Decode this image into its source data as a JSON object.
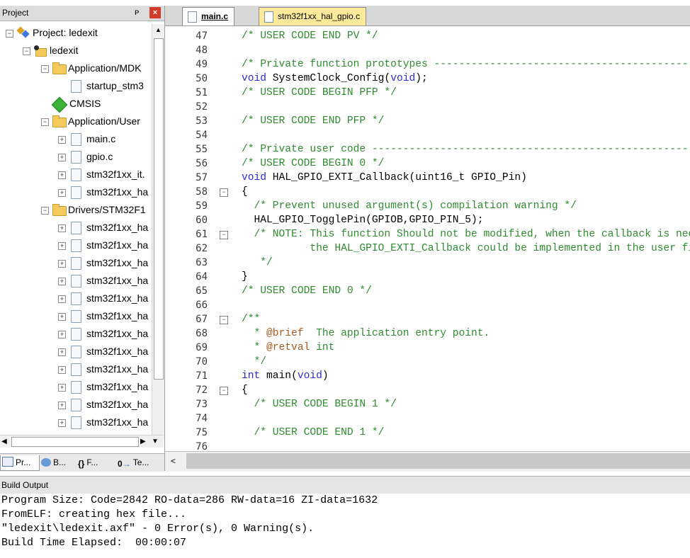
{
  "project_panel": {
    "title": "Project",
    "pin": "ᴘ",
    "close": "×",
    "tree": [
      {
        "label": "Project: ledexit",
        "type": "project",
        "level": 0,
        "expander": "−"
      },
      {
        "label": "ledexit",
        "type": "target",
        "level": 1,
        "expander": "−"
      },
      {
        "label": "Application/MDK",
        "type": "folder",
        "level": 2,
        "expander": "−"
      },
      {
        "label": "startup_stm3",
        "type": "file",
        "level": 3,
        "expander": ""
      },
      {
        "label": "CMSIS",
        "type": "gem",
        "level": 2,
        "expander": ""
      },
      {
        "label": "Application/User",
        "type": "folder",
        "level": 2,
        "expander": "−"
      },
      {
        "label": "main.c",
        "type": "file",
        "level": 3,
        "expander": "+"
      },
      {
        "label": "gpio.c",
        "type": "file",
        "level": 3,
        "expander": "+"
      },
      {
        "label": "stm32f1xx_it.",
        "type": "file",
        "level": 3,
        "expander": "+"
      },
      {
        "label": "stm32f1xx_ha",
        "type": "file",
        "level": 3,
        "expander": "+"
      },
      {
        "label": "Drivers/STM32F1",
        "type": "folder",
        "level": 2,
        "expander": "−"
      },
      {
        "label": "stm32f1xx_ha",
        "type": "file",
        "level": 3,
        "expander": "+"
      },
      {
        "label": "stm32f1xx_ha",
        "type": "file",
        "level": 3,
        "expander": "+"
      },
      {
        "label": "stm32f1xx_ha",
        "type": "file",
        "level": 3,
        "expander": "+"
      },
      {
        "label": "stm32f1xx_ha",
        "type": "file",
        "level": 3,
        "expander": "+"
      },
      {
        "label": "stm32f1xx_ha",
        "type": "file",
        "level": 3,
        "expander": "+"
      },
      {
        "label": "stm32f1xx_ha",
        "type": "file",
        "level": 3,
        "expander": "+"
      },
      {
        "label": "stm32f1xx_ha",
        "type": "file",
        "level": 3,
        "expander": "+"
      },
      {
        "label": "stm32f1xx_ha",
        "type": "file",
        "level": 3,
        "expander": "+"
      },
      {
        "label": "stm32f1xx_ha",
        "type": "file",
        "level": 3,
        "expander": "+"
      },
      {
        "label": "stm32f1xx_ha",
        "type": "file",
        "level": 3,
        "expander": "+"
      },
      {
        "label": "stm32f1xx_ha",
        "type": "file",
        "level": 3,
        "expander": "+"
      },
      {
        "label": "stm32f1xx_ha",
        "type": "file",
        "level": 3,
        "expander": "+"
      }
    ],
    "bottom_tabs": [
      {
        "label": "Pr...",
        "icon": "project-tab-icon"
      },
      {
        "label": "B...",
        "icon": "books-tab-icon"
      },
      {
        "label": "F...",
        "icon": "functions-tab-icon"
      },
      {
        "label": "Te...",
        "icon": "templates-tab-icon"
      }
    ]
  },
  "editor": {
    "tabs": [
      {
        "label": "main.c",
        "active": true
      },
      {
        "label": "stm32f1xx_hal_gpio.c",
        "active": false
      }
    ],
    "lines": [
      {
        "n": "47",
        "fold": "",
        "html": "<span class=\"cm\">/* USER CODE END PV */</span>"
      },
      {
        "n": "48",
        "fold": "",
        "html": ""
      },
      {
        "n": "49",
        "fold": "",
        "html": "<span class=\"cm\">/* Private function prototypes -----------------------------------------------</span>"
      },
      {
        "n": "50",
        "fold": "",
        "html": "<span class=\"kw\">void</span> SystemClock_Config(<span class=\"kw\">void</span>);"
      },
      {
        "n": "51",
        "fold": "",
        "html": "<span class=\"cm\">/* USER CODE BEGIN PFP */</span>"
      },
      {
        "n": "52",
        "fold": "",
        "html": ""
      },
      {
        "n": "53",
        "fold": "",
        "html": "<span class=\"cm\">/* USER CODE END PFP */</span>"
      },
      {
        "n": "54",
        "fold": "",
        "html": ""
      },
      {
        "n": "55",
        "fold": "",
        "html": "<span class=\"cm\">/* Private user code ---------------------------------------------------------</span>"
      },
      {
        "n": "56",
        "fold": "",
        "html": "<span class=\"cm\">/* USER CODE BEGIN 0 */</span>"
      },
      {
        "n": "57",
        "fold": "",
        "html": "<span class=\"kw\">void</span> HAL_GPIO_EXTI_Callback(uint16_t GPIO_Pin)"
      },
      {
        "n": "58",
        "fold": "−",
        "html": "{"
      },
      {
        "n": "59",
        "fold": "",
        "html": "  <span class=\"cm\">/* Prevent unused argument(s) compilation warning */</span>"
      },
      {
        "n": "60",
        "fold": "",
        "html": "  HAL_GPIO_TogglePin(GPIOB,GPIO_PIN_5);"
      },
      {
        "n": "61",
        "fold": "−",
        "html": "  <span class=\"cm\">/* NOTE: This function Should not be modified, when the callback is needed,</span>"
      },
      {
        "n": "62",
        "fold": "",
        "html": "<span class=\"cm\">           the HAL_GPIO_EXTI_Callback could be implemented in the user file</span>"
      },
      {
        "n": "63",
        "fold": "",
        "html": "   <span class=\"cm\">*/</span>"
      },
      {
        "n": "64",
        "fold": "",
        "html": "}"
      },
      {
        "n": "65",
        "fold": "",
        "html": "<span class=\"cm\">/* USER CODE END 0 */</span>"
      },
      {
        "n": "66",
        "fold": "",
        "html": ""
      },
      {
        "n": "67",
        "fold": "−",
        "html": "<span class=\"cm\">/**</span>"
      },
      {
        "n": "68",
        "fold": "",
        "html": "<span class=\"cm\">  * </span><span class=\"tagc\">@brief</span><span class=\"cm\">  The application entry point.</span>"
      },
      {
        "n": "69",
        "fold": "",
        "html": "<span class=\"cm\">  * </span><span class=\"tagc\">@retval</span><span class=\"cm\"> int</span>"
      },
      {
        "n": "70",
        "fold": "",
        "html": "<span class=\"cm\">  */</span>"
      },
      {
        "n": "71",
        "fold": "",
        "html": "<span class=\"kw\">int</span> main(<span class=\"kw\">void</span>)"
      },
      {
        "n": "72",
        "fold": "−",
        "html": "{"
      },
      {
        "n": "73",
        "fold": "",
        "html": "  <span class=\"cm\">/* USER CODE BEGIN 1 */</span>"
      },
      {
        "n": "74",
        "fold": "",
        "html": ""
      },
      {
        "n": "75",
        "fold": "",
        "html": "  <span class=\"cm\">/* USER CODE END 1 */</span>"
      },
      {
        "n": "76",
        "fold": "",
        "html": ""
      }
    ],
    "hscroll_left": "<"
  },
  "build_output": {
    "title": "Build Output",
    "lines": [
      "Program Size: Code=2842 RO-data=286 RW-data=16 ZI-data=1632",
      "FromELF: creating hex file...",
      "\"ledexit\\ledexit.axf\" - 0 Error(s), 0 Warning(s).",
      "Build Time Elapsed:  00:00:07"
    ]
  },
  "colors": {
    "comment": "#2e8b2e",
    "keyword": "#2b2bd6",
    "doc_tag": "#a65a1e",
    "inactive_tab": "#fde99a",
    "close_button": "#d33a2c"
  }
}
